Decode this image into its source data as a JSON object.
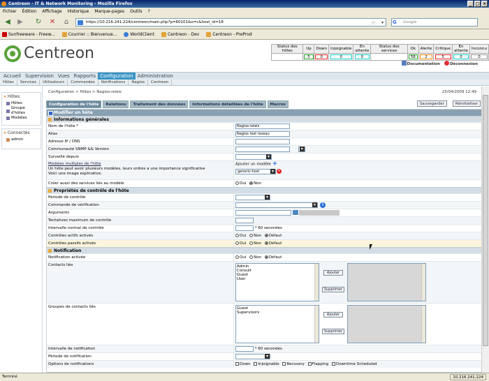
{
  "window": {
    "title": "Centreon - IT & Network Monitoring - Mozilla Firefox"
  },
  "menubar": [
    "Fichier",
    "Édition",
    "Affichage",
    "Historique",
    "Marque-pages",
    "Outils",
    "?"
  ],
  "url": "https://10.216.241.224/centreon/main.php?p=60101&o=c&host_id=18",
  "search_placeholder": "Google",
  "bookmarks": [
    "Sunfreeware - Freew...",
    "Courrier :: Bienvenue...",
    "WorldClient",
    "Centreon - Dev",
    "Centreon - PreProd"
  ],
  "brand": "Centreon",
  "status": {
    "hosts_label": "Status des hôtes",
    "services_label": "Status des services",
    "host_cols": [
      "Up",
      "Down",
      "Injoignable",
      "En attente"
    ],
    "host_vals": [
      "5",
      "0",
      "0",
      "0"
    ],
    "svc_cols": [
      "Ok",
      "Alerte",
      "Critique",
      "En attente",
      "Inconnu"
    ],
    "svc_vals": [
      "58",
      "2",
      "5",
      "0",
      "0"
    ]
  },
  "links": {
    "documentation": "Documentation",
    "logout": "Déconnexion"
  },
  "main_menu": [
    "Accueil",
    "Supervision",
    "Vues",
    "Rapports",
    "Configuration",
    "Administration"
  ],
  "sub_menu": [
    "Hôtes",
    "Services",
    "Utilisateurs",
    "Commandes",
    "Notifications",
    "Nagios",
    "Centreon"
  ],
  "sidebar": {
    "hosts_title": "Hôtes",
    "hosts_items": [
      "Hôtes",
      "Groupe d'hôtes",
      "Modèles"
    ],
    "connected_title": "Connectés",
    "user": "admin"
  },
  "breadcrumb": "Configuration > Hôtes > Nagios-relais",
  "date": "23/04/2009 12:49",
  "tabs": [
    "Configuration de l'hôte",
    "Relations",
    "Traitement des données",
    "Informations détaillées de l'hôte",
    "Macros"
  ],
  "buttons": {
    "save": "Sauvegarder",
    "reset": "Réinitialiser",
    "add": "Ajouter",
    "remove": "Supprimer"
  },
  "form": {
    "title": "Modifier un hôte",
    "sec_general": "Informations générales",
    "name_label": "Nom de l'hôte *",
    "name_value": "Nagios-relais",
    "alias_label": "Alias",
    "alias_value": "Nagios test reseau",
    "ip_label": "Adresse IP / DNS",
    "snmp_label": "Communauté SNMP && Version",
    "monitored_from_label": "Surveillé depuis",
    "templates_label": "Modèles multiples de l'hôte",
    "templates_desc1": "Un hôte peut avoir plusieurs modèles, leurs ordres a une importance significative",
    "templates_desc2": "Voici une image explicative.",
    "add_template": "Ajouter un modèle",
    "template_value": "generic-host",
    "create_services_label": "Créer aussi des services liés au modèle",
    "yes": "Oui",
    "no": "Non",
    "default": "Défaut",
    "sec_control": "Propriétés de contrôle de l'hôte",
    "period_label": "Période de contrôle",
    "check_cmd_label": "Commande de vérification",
    "args_label": "Arguments",
    "max_attempts_label": "Tentatives maximum de contrôle",
    "interval_label": "Intervalle normal de contrôle",
    "seconds_suffix": "* 60 secondes",
    "active_checks_label": "Contrôles actifs activés",
    "passive_checks_label": "Contrôles passifs activés",
    "sec_notif": "Notification",
    "notif_enabled_label": "Notification activée",
    "contacts_label": "Contacts liés",
    "contacts": [
      "Admin",
      "Consult",
      "Guest",
      "User"
    ],
    "contact_groups_label": "Groupes de contacts liés",
    "contact_groups": [
      "Guest",
      "Supervisors"
    ],
    "notif_interval_label": "Intervalle de notification",
    "notif_period_label": "Période de notification",
    "notif_options_label": "Options de notifications",
    "notif_options": [
      "Down",
      "Injoignable",
      "Recovery",
      "Flapping",
      "Downtime Scheduled"
    ]
  },
  "statusbar": {
    "text": "Terminé",
    "ip": "10.216.241.224"
  }
}
